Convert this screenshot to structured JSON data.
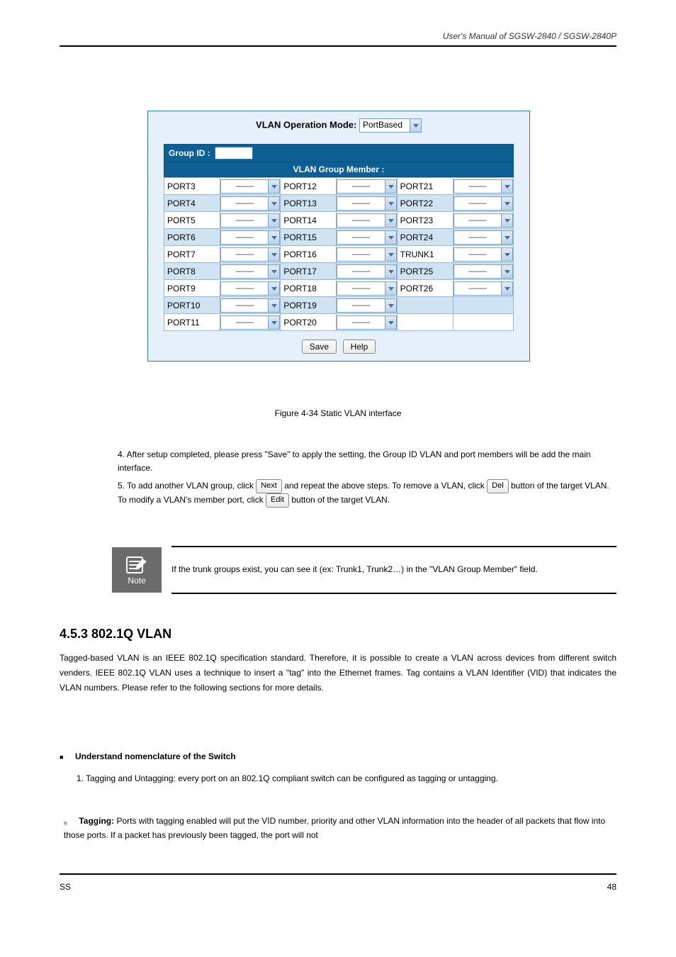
{
  "header_right": "User's Manual of SGSW-2840 / SGSW-2840P",
  "vlan_mode_label": "VLAN Operation Mode:",
  "vlan_mode_value": "PortBased",
  "group_id_label": "Group ID :",
  "vgm_title": "VLAN Group Member :",
  "dash": "--------",
  "ports": [
    [
      "PORT3",
      "PORT12",
      "PORT21"
    ],
    [
      "PORT4",
      "PORT13",
      "PORT22"
    ],
    [
      "PORT5",
      "PORT14",
      "PORT23"
    ],
    [
      "PORT6",
      "PORT15",
      "PORT24"
    ],
    [
      "PORT7",
      "PORT16",
      "TRUNK1"
    ],
    [
      "PORT8",
      "PORT17",
      "PORT25"
    ],
    [
      "PORT9",
      "PORT18",
      "PORT26"
    ],
    [
      "PORT10",
      "PORT19",
      ""
    ],
    [
      "PORT11",
      "PORT20",
      ""
    ]
  ],
  "save_btn": "Save",
  "help_btn": "Help",
  "caption1": "Figure 4-34 Static VLAN interface",
  "instr": {
    "line4": "4. After setup completed, please press \"Save\" to apply the setting, the Group ID VLAN and port members will be add the main interface.",
    "line5a": "5. To add another VLAN group, click ",
    "next_btn": "Next",
    "line5b": " and repeat the above steps. To remove a VLAN, click ",
    "del_btn": "Del",
    "line5c": " button of the target VLAN. To modify a VLAN's member port, click ",
    "edit_btn": "Edit",
    "line5d": " button of the target VLAN."
  },
  "note_text": "If the trunk groups exist, you can see it (ex: Trunk1, Trunk2…) in the \"VLAN Group Member\" field.",
  "h3": "4.5.3 802.1Q VLAN",
  "para1": "Tagged-based VLAN is an IEEE 802.1Q specification standard. Therefore, it is possible to create a VLAN across devices from different switch venders. IEEE 802.1Q VLAN uses a technique to insert a \"tag\" into the Ethernet frames. Tag contains a VLAN Identifier (VID) that indicates the VLAN numbers. Please refer to the following sections for more details.",
  "bullet_title": "Understand nomenclature of the Switch",
  "sub1": "1. Tagging and Untagging: every port on an 802.1Q compliant switch can be configured as tagging or untagging.",
  "step2": {
    "n": "。",
    "bold": "Tagging:",
    "rest": " Ports with tagging enabled will put the VID number, priority and other VLAN information into the header of all packets that flow into those ports. If a packet has previously been tagged, the port will not"
  },
  "foot_left": "SS",
  "foot_right": "48"
}
